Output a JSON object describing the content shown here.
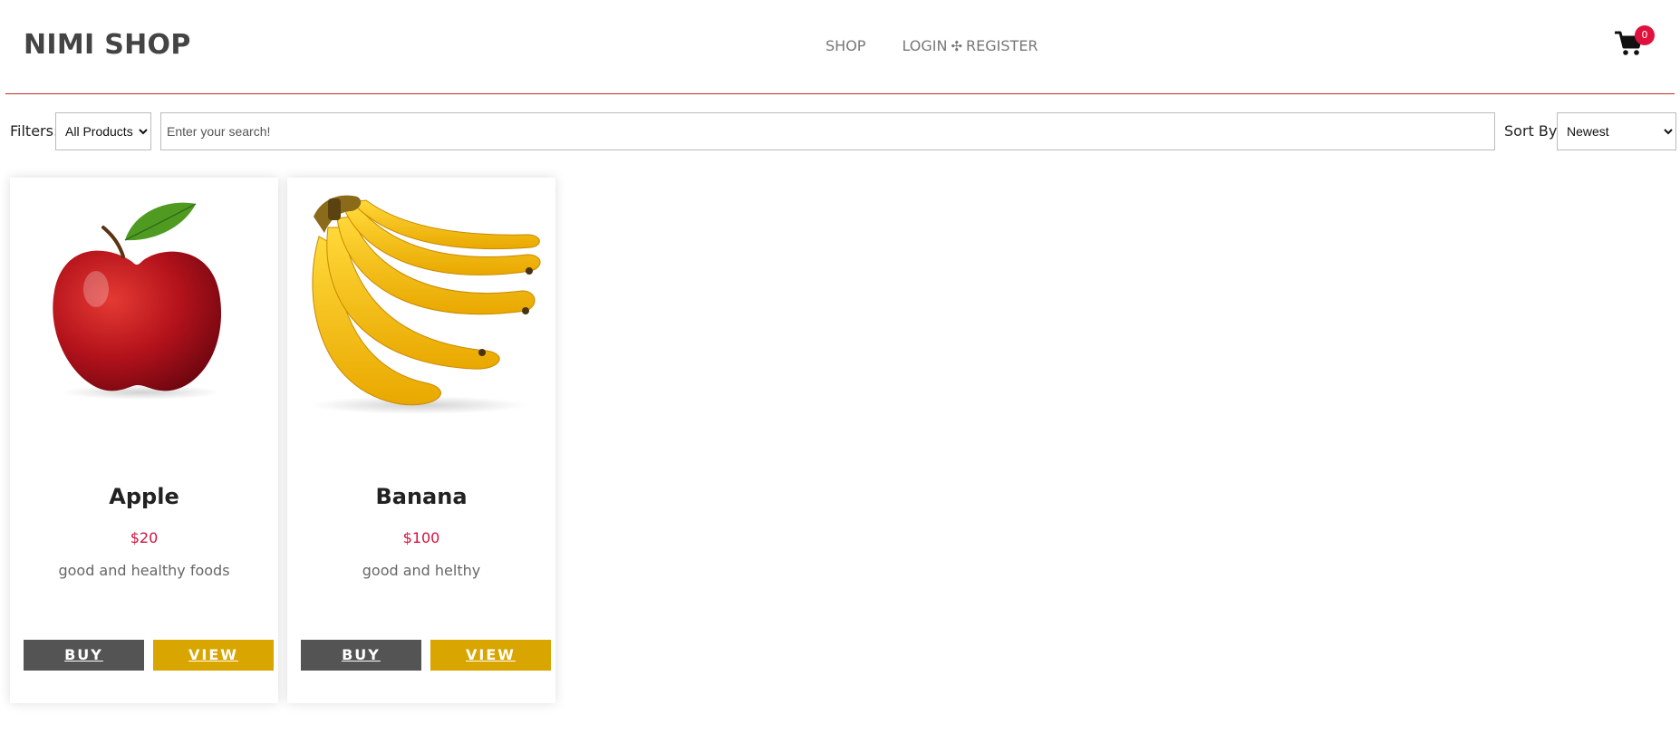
{
  "header": {
    "brand": "NIMI SHOP",
    "nav": {
      "shop": "SHOP",
      "login": "LOGIN",
      "separator": "✣",
      "register": "REGISTER"
    },
    "cart": {
      "icon": "cart-icon",
      "count": "0"
    }
  },
  "filters": {
    "label": "Filters:",
    "category_selected": "All Products",
    "search_placeholder": "Enter your search!",
    "sort_label": "Sort By:",
    "sort_selected": "Newest"
  },
  "products": [
    {
      "name": "Apple",
      "price": "$20",
      "description": "good and healthy foods",
      "buy_label": "BUY",
      "view_label": "VIEW"
    },
    {
      "name": "Banana",
      "price": "$100",
      "description": "good and helthy",
      "buy_label": "BUY",
      "view_label": "VIEW"
    }
  ],
  "colors": {
    "accent": "#d6123c",
    "view_button": "#d9a500",
    "buy_button": "#545454",
    "badge": "#e0113c"
  }
}
